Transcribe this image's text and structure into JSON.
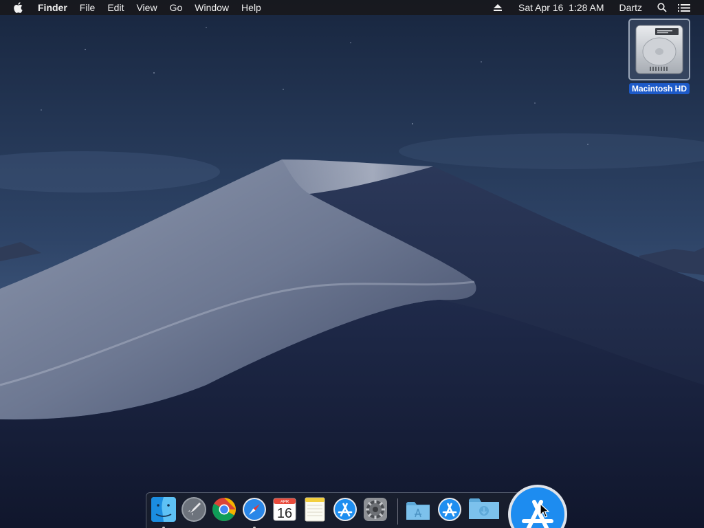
{
  "menubar": {
    "apple_icon": "apple-logo-icon",
    "app_name": "Finder",
    "menus": [
      "File",
      "Edit",
      "View",
      "Go",
      "Window",
      "Help"
    ],
    "eject_icon": "eject-icon",
    "datetime": "Sat Apr 16  1:28 AM",
    "user": "Dartz",
    "spotlight_icon": "magnifier-icon",
    "notification_icon": "list-icon"
  },
  "desktop": {
    "icons": [
      {
        "label": "Macintosh HD",
        "icon": "hard-drive-icon",
        "selected": true
      }
    ]
  },
  "dock": {
    "apps": [
      {
        "icon": "finder-icon",
        "running": true
      },
      {
        "icon": "launchpad-rocket-icon",
        "running": false
      },
      {
        "icon": "chrome-icon",
        "running": false
      },
      {
        "icon": "safari-compass-icon",
        "running": true
      },
      {
        "icon": "calendar-icon",
        "running": false,
        "month": "APR",
        "day": "16"
      },
      {
        "icon": "notes-icon",
        "running": false
      },
      {
        "icon": "app-store-icon",
        "running": false
      },
      {
        "icon": "system-preferences-gear-icon",
        "running": false
      }
    ],
    "stacks": [
      {
        "icon": "applications-folder-icon"
      },
      {
        "icon": "app-store-icon"
      },
      {
        "icon": "downloads-folder-icon"
      }
    ],
    "magnified": {
      "icon": "app-store-icon"
    }
  },
  "colors": {
    "menubar": "#18181c",
    "selection": "#1d5ac9",
    "sky": "#1a2a44",
    "dune_light": "#9aa3b8",
    "dune_shadow": "#1b2544"
  }
}
